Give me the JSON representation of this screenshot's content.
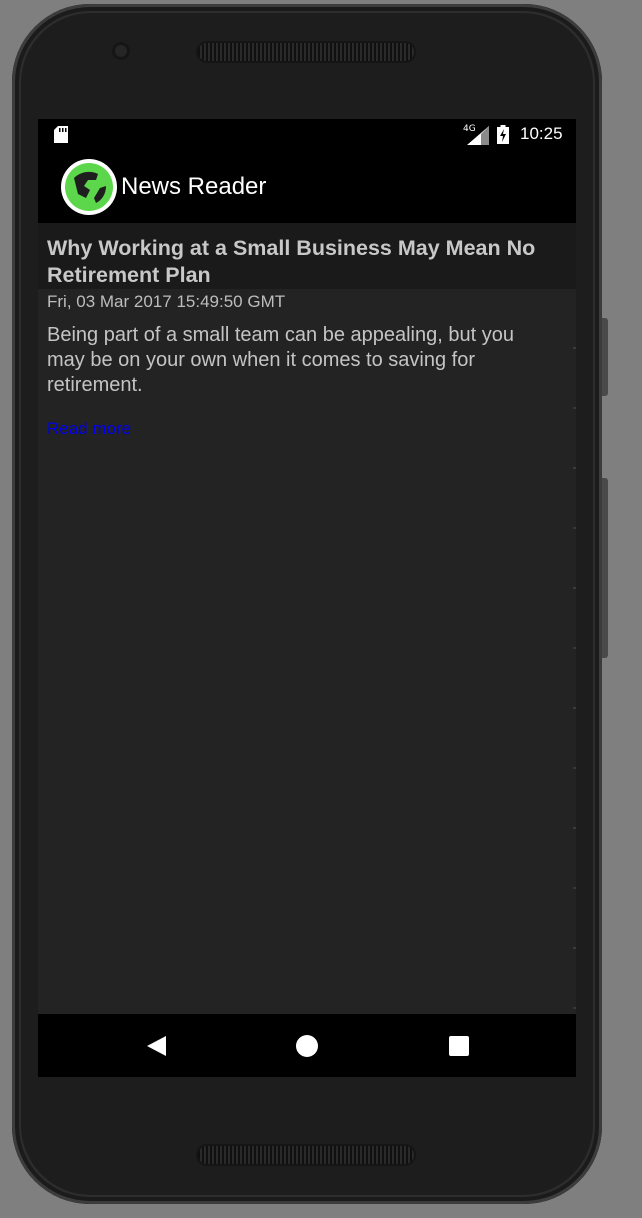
{
  "status_bar": {
    "network": "4G",
    "time": "10:25",
    "icons": [
      "sd-card-icon",
      "signal-icon",
      "battery-icon"
    ]
  },
  "app_bar": {
    "title": "News Reader",
    "logo_icon": "globe-icon"
  },
  "article": {
    "title": "Why Working at a Small Business May Mean No Retirement Plan",
    "date": "Fri, 03 Mar 2017 15:49:50 GMT",
    "description": "Being part of a small team can be appealing, but you may be on your own when it comes to saving for retirement.",
    "read_more": "Read more"
  },
  "nav_bar": {
    "buttons": [
      "back-icon",
      "home-icon",
      "recents-icon"
    ]
  },
  "colors": {
    "app_bar": "#000000",
    "background": "#222322",
    "headline_bg": "#1a1a1a",
    "link": "#0000ee",
    "logo_green": "#5cd64a"
  }
}
